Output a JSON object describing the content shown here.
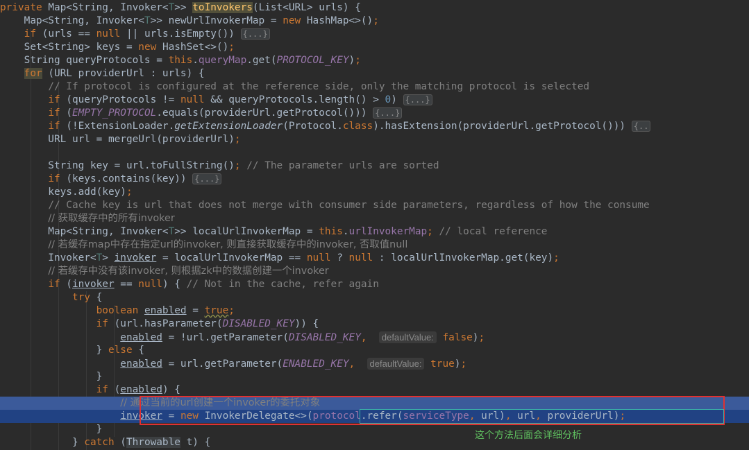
{
  "editor": {
    "lines": [
      "private Map<String, Invoker<T>> toInvokers(List<URL> urls) {",
      "    Map<String, Invoker<T>> newUrlInvokerMap = new HashMap<>();",
      "    if (urls == null || urls.isEmpty()) {...}",
      "    Set<String> keys = new HashSet<>();",
      "    String queryProtocols = this.queryMap.get(PROTOCOL_KEY);",
      "    for (URL providerUrl : urls) {",
      "        // If protocol is configured at the reference side, only the matching protocol is selected",
      "        if (queryProtocols != null && queryProtocols.length() > 0) {...}",
      "        if (EMPTY_PROTOCOL.equals(providerUrl.getProtocol())) {...}",
      "        if (!ExtensionLoader.getExtensionLoader(Protocol.class).hasExtension(providerUrl.getProtocol())) {..",
      "        URL url = mergeUrl(providerUrl);",
      "",
      "        String key = url.toFullString(); // The parameter urls are sorted",
      "        if (keys.contains(key)) {...}",
      "        keys.add(key);",
      "        // Cache key is url that does not merge with consumer side parameters, regardless of how the consume",
      "        // 获取缓存中的所有invoker",
      "        Map<String, Invoker<T>> localUrlInvokerMap = this.urlInvokerMap; // local reference",
      "        // 若缓存map中存在指定url的invoker, 则直接获取缓存中的invoker, 否取值null",
      "        Invoker<T> invoker = localUrlInvokerMap == null ? null : localUrlInvokerMap.get(key);",
      "        // 若缓存中没有该invoker, 则根据zk中的数据创建一个invoker",
      "        if (invoker == null) { // Not in the cache, refer again",
      "            try {",
      "                boolean enabled = true;",
      "                if (url.hasParameter(DISABLED_KEY)) {",
      "                    enabled = !url.getParameter(DISABLED_KEY, defaultValue: false);",
      "                } else {",
      "                    enabled = url.getParameter(ENABLED_KEY, defaultValue: true);",
      "                }",
      "                if (enabled) {",
      "                    // 通过当前的url创建一个invoker的委托对象",
      "                    invoker = new InvokerDelegate<>(protocol.refer(serviceType, url), url, providerUrl);",
      "                }",
      "            } catch (Throwable t) {"
    ],
    "hint_label": "defaultValue:"
  },
  "annotation": {
    "note": "这个方法后面会详细分析"
  },
  "colors": {
    "background": "#2b2b2b",
    "keyword": "#cc7832",
    "field": "#9876aa",
    "comment": "#808080",
    "method_highlight": "#ffc66d",
    "selection": "#214283",
    "annotation_box": "#e03131",
    "annotation_text": "#5fbf5f"
  }
}
